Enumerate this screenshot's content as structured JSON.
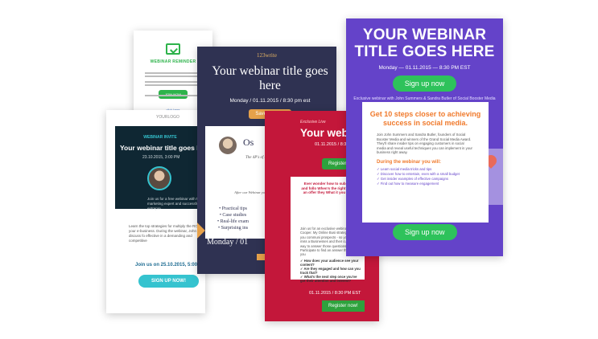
{
  "colors": {
    "reminder_green": "#2eb34b",
    "invite_teal": "#35c3cf",
    "invite_dark": "#0f2733",
    "write_navy": "#2f3252",
    "write_gold": "#e6a14a",
    "red": "#c3173a",
    "purple": "#6443c9",
    "cta_green": "#2ec25b",
    "accent_orange": "#f07a2c"
  },
  "reminder": {
    "icon": "calendar-icon",
    "title": "WEBINAR REMINDER",
    "button": "JOIN NOW",
    "link": "click here"
  },
  "invite": {
    "logo": "YOURLOGO",
    "kicker": "WEBINAR INVITE",
    "title": "Your webinar title goes l",
    "date": "23.10.2015, 3:00 PM",
    "intro": "Join us for a free webinar with Mike Smi marketing expert and successful entrepre",
    "body": "Learn the top strategies for multiply the ROI of your e-business. During the webinar, John will discuss fo effective in a demanding and competitive",
    "join": "Join us on 25.10.2015, 5:00 P",
    "button": "SIGN UP NOW!"
  },
  "write": {
    "brand": "123write",
    "title": "Your webinar title goes here",
    "date": "Monday / 01.11.2015 / 8:30 pm est",
    "button": "Save my seat",
    "presenter": "Os",
    "quote": "The 4P's of copy of every copyw do they really to work for yo",
    "after": "After our Webinar you'll agan about which fu",
    "bullets": [
      "Practical tips",
      "Case studies",
      "Real-life exam",
      "Surprising ins"
    ],
    "date_bottom": "Monday / 01"
  },
  "red": {
    "kicker": "Exclusive Live",
    "title": "Your webi goes",
    "date": "01.11.2015 / 8:30",
    "button": "Register",
    "questions": "Ever wonder how to subscribers, and follo When's the right mom with an offer they What it you do, but it",
    "body": "Join us for an exclusive webinar Charlie Cooper. My Online Busi strategies will help you communi prospects - so you never miss a Businesses and their customers way to answer those questions a Participate to find an answer that's right for you",
    "checks": [
      "How does your audience see your content?",
      "Are they engaged and how can you track that?",
      "What's the next step once you've got their attention and interest?"
    ],
    "date_bottom": "01.11.2015 / 8:30 PM EST",
    "button_bottom": "Register now!"
  },
  "purple": {
    "title": "YOUR WEBINAR TITLE GOES HERE",
    "date": "Monday — 01.11.2015 — 8:30 PM EST",
    "button": "Sign up now",
    "exclusive": "Exclusive webinar with John Summers & Sandra Butler of Social Booster Media",
    "panel_title": "Get 10 steps closer to achieving success in social media.",
    "panel_body": "Join John Summers and Sandra Butler, founders of Social Booster Media and winners of the Grand Social Media Award. They'll share insider tips on engaging customers in social media and reveal useful techniques you can implement in your business right away.",
    "will_title": "During the webinar you will:",
    "will_list": [
      "Learn social media tricks and tips",
      "Discover how to entertain, even with a small budget",
      "Get insider examples of effective campaigns",
      "Find out how to measure engagement"
    ],
    "date_bottom": "Monday — 01.11.2015 — 8:30 PM EST",
    "button_bottom": "Sign up now"
  }
}
